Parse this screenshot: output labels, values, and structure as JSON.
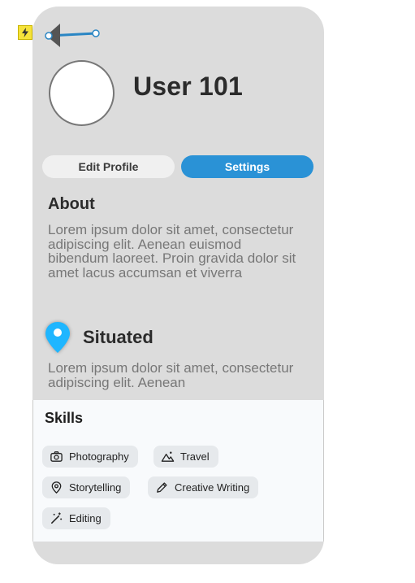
{
  "profile": {
    "name": "User 101"
  },
  "buttons": {
    "edit_profile": "Edit Profile",
    "settings": "Settings"
  },
  "about": {
    "title": "About",
    "text": "Lorem ipsum dolor sit amet, consectetur adipiscing elit. Aenean euismod bibendum laoreet. Proin gravida dolor sit amet lacus accumsan et viverra"
  },
  "situated": {
    "title": "Situated",
    "text": "Lorem ipsum dolor sit amet, consectetur adipiscing elit. Aenean"
  },
  "skills": {
    "title": "Skills",
    "items": [
      {
        "label": "Photography",
        "icon": "camera-icon"
      },
      {
        "label": "Travel",
        "icon": "mountain-icon"
      },
      {
        "label": "Storytelling",
        "icon": "map-pin-icon"
      },
      {
        "label": "Creative Writing",
        "icon": "pencil-icon"
      },
      {
        "label": "Editing",
        "icon": "magic-wand-icon"
      }
    ]
  },
  "colors": {
    "accent": "#2a92d6",
    "background": "#dcdcdc",
    "pin": "#1fb6ff"
  }
}
